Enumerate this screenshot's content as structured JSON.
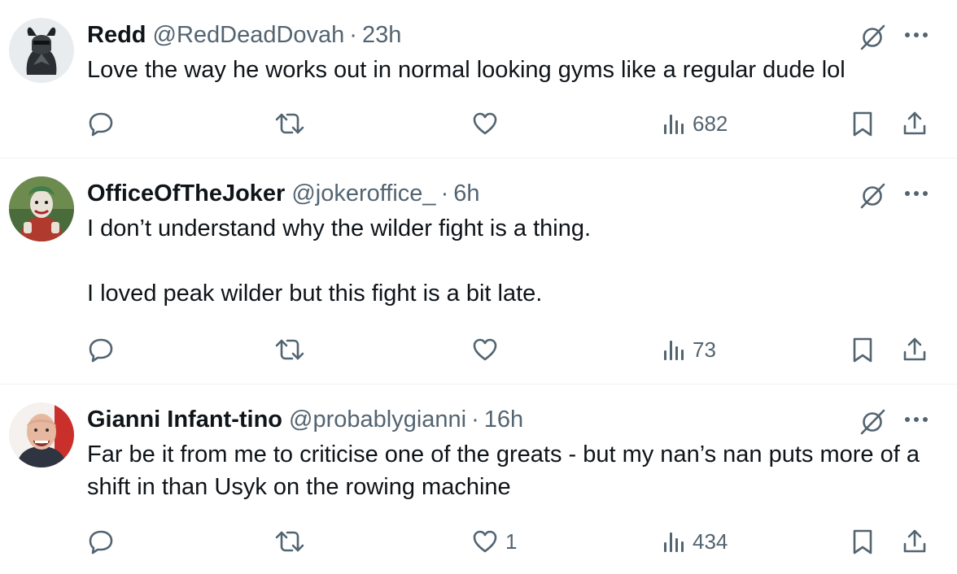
{
  "tweets": [
    {
      "display_name": "Redd",
      "handle": "@RedDeadDovah",
      "separator": "·",
      "time": "23h",
      "text": "Love the way he works out in normal looking gyms like a regular dude lol",
      "reply_count": "",
      "retweet_count": "",
      "like_count": "",
      "view_count": "682"
    },
    {
      "display_name": "OfficeOfTheJoker",
      "handle": "@jokeroffice_",
      "separator": "·",
      "time": "6h",
      "text": "I don’t understand why the wilder fight is a thing.\n\nI loved peak wilder but this fight is a bit late.",
      "reply_count": "",
      "retweet_count": "",
      "like_count": "",
      "view_count": "73"
    },
    {
      "display_name": "Gianni Infant-tino",
      "handle": "@probablygianni",
      "separator": "·",
      "time": "16h",
      "text": "Far be it from me to criticise one of the greats - but my nan’s nan puts more of a shift in than Usyk on the rowing machine",
      "reply_count": "",
      "retweet_count": "",
      "like_count": "1",
      "view_count": "434"
    }
  ],
  "colors": {
    "text_primary": "#0f1419",
    "text_secondary": "#536471",
    "divider": "#eff3f4"
  },
  "icons": [
    "grok-icon",
    "more-icon",
    "reply-icon",
    "retweet-icon",
    "like-icon",
    "views-icon",
    "bookmark-icon",
    "share-icon"
  ]
}
